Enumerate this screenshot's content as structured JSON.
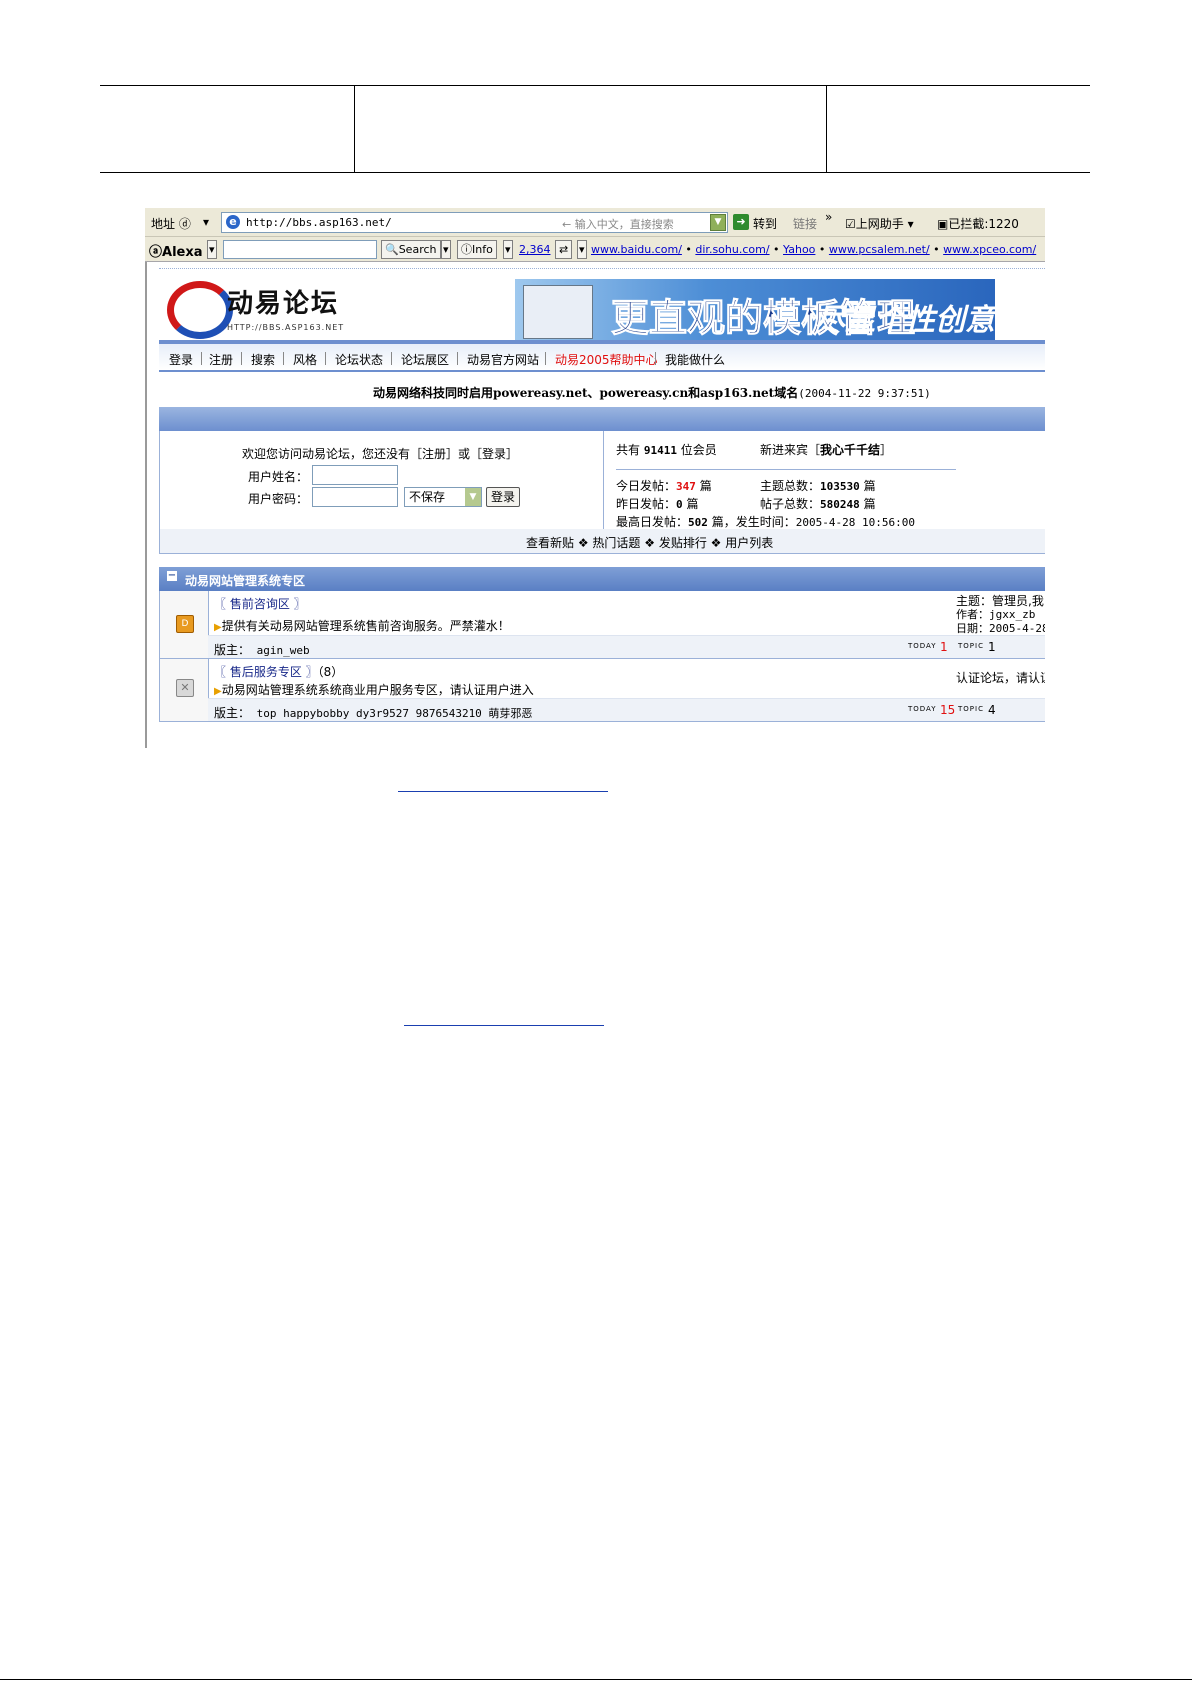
{
  "browser": {
    "address_label": "地址 ⓓ",
    "url": "http://bbs.asp163.net/",
    "search_hint": "输入中文，直接搜索",
    "go_label": "转到",
    "links_label": "链接",
    "more_label": "»",
    "helper_label": "上网助手",
    "blocked_label": "已拦截:1220"
  },
  "alexa": {
    "logo": "Alexa",
    "search_btn": "Search",
    "info_btn": "Info",
    "rank": "2,364",
    "links": [
      "www.baidu.com/",
      "dir.sohu.com/",
      "Yahoo",
      "www.pcsalem.net/",
      "www.xpceo.com/"
    ]
  },
  "site": {
    "logo_title": "动易论坛",
    "logo_url": "HTTP://BBS.ASP163.NET",
    "ad_text1": "更直观的模板管理",
    "ad_text2": "尽显个性创意"
  },
  "nav": {
    "items": [
      "登录",
      "注册",
      "搜索",
      "风格",
      "论坛状态",
      "论坛展区",
      "动易官方网站",
      "动易2005帮助中心",
      "我能做什么"
    ],
    "highlight_color": "#e01010"
  },
  "news": {
    "headline": "动易网络科技同时启用powereasy.net、powereasy.cn和asp163.net域名",
    "date": "(2004-11-22 9:37:51)"
  },
  "login": {
    "welcome": "欢迎您访问动易论坛，您还没有［注册］或［登录］",
    "username_label": "用户姓名：",
    "password_label": "用户密码：",
    "save_option": "不保存",
    "submit": "登录"
  },
  "stats": {
    "members_label": "共有",
    "members": "91411",
    "members_unit": "位会员",
    "newcomer_label": "新进来宾［",
    "newcomer": "我心千千结",
    "newcomer_end": "］",
    "today_label": "今日发帖：",
    "today": "347",
    "unit_pian": "篇",
    "topics_label": "主题总数：",
    "topics": "103530",
    "yesterday_label": "昨日发帖：",
    "yesterday": "0",
    "posts_label": "帖子总数：",
    "posts": "580248",
    "max_label": "最高日发帖：",
    "max": "502",
    "max_time_label": "篇，发生时间：",
    "max_time": "2005-4-28 10:56:00"
  },
  "quick_links": [
    "查看新贴",
    "热门话题",
    "发贴排行",
    "用户列表"
  ],
  "zone": {
    "title": "动易网站管理系统专区",
    "toggle": "−"
  },
  "forums": [
    {
      "title": "〖 售前咨询区 〗",
      "count": "",
      "desc": "提供有关动易网站管理系统售前咨询服务。严禁灌水！",
      "mod_label": "版主：",
      "mods": "agin_web",
      "today_label": "TODAY",
      "today": "1",
      "topic_label": "TOPIC",
      "topic": "1",
      "info1": "主题：管理员,我",
      "info2": "作者：jgxx_zb",
      "info3": "日期：2005-4-28"
    },
    {
      "title": "〖 售后服务专区 〗",
      "count": "（8）",
      "desc": "动易网站管理系统系统商业用户服务专区，请认证用户进入",
      "mod_label": "版主：",
      "mods": "top happybobby dy3r9527 9876543210 萌芽邪恶",
      "today_label": "TODAY",
      "today": "15",
      "topic_label": "TOPIC",
      "topic": "4",
      "info1": "认证论坛，请认证"
    }
  ]
}
